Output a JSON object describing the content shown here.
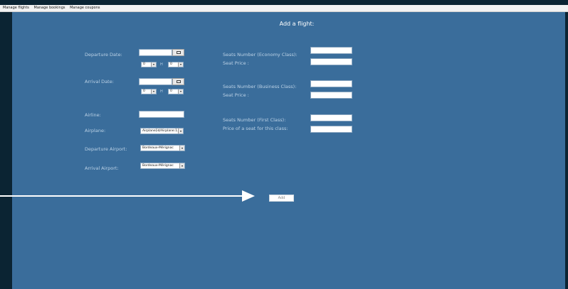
{
  "menu": [
    "Manage flights",
    "Manage bookings",
    "Manage coupons"
  ],
  "title": "Add a flight:",
  "left": {
    "departure_date": "Departure Date:",
    "arrival_date": "Arrival Date:",
    "airline": "Airline:",
    "airplane": "Airplane:",
    "departure_airport": "Departure Airport:",
    "arrival_airport": "Arrival Airport:"
  },
  "time": {
    "dep_hour": "0",
    "dep_min": "0",
    "arr_hour": "0",
    "arr_min": "0",
    "h_label": "H"
  },
  "selects": {
    "airplane": "Airplane[id/Airplane:1...",
    "departure_airport": "Bordeaux-Mérignac",
    "arrival_airport": "Bordeaux-Mérignac"
  },
  "right": {
    "economy_seats": "Seats Number (Economy Class):",
    "economy_price": "Seat Price :",
    "business_seats": "Seats Number (Business Class):",
    "business_price": "Seat Price :",
    "first_seats": "Seats Number (First Class):",
    "first_price": "Price of a seat for this class:"
  },
  "add_label": "Add",
  "icons": {
    "calendar": "calendar-icon",
    "dropdown": "chevron-down-icon"
  }
}
